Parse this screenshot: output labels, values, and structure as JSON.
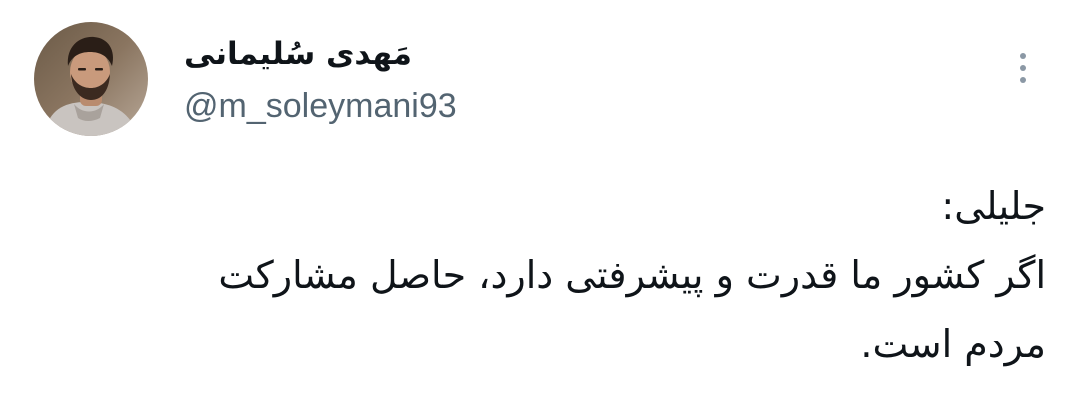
{
  "tweet": {
    "author": {
      "display_name": "مَهدی سُلیمانی",
      "handle": "@m_soleymani93",
      "avatar_icon": "profile-photo"
    },
    "more_icon": "vertical-ellipsis-icon",
    "body_lines": [
      "جلیلی:",
      "اگر کشور ما قدرت و پیشرفتی دارد، حاصل مشارکت",
      "مردم است."
    ]
  },
  "colors": {
    "text": "#0f1419",
    "secondary": "#536471",
    "icon": "#8b98a5",
    "background": "#ffffff"
  }
}
